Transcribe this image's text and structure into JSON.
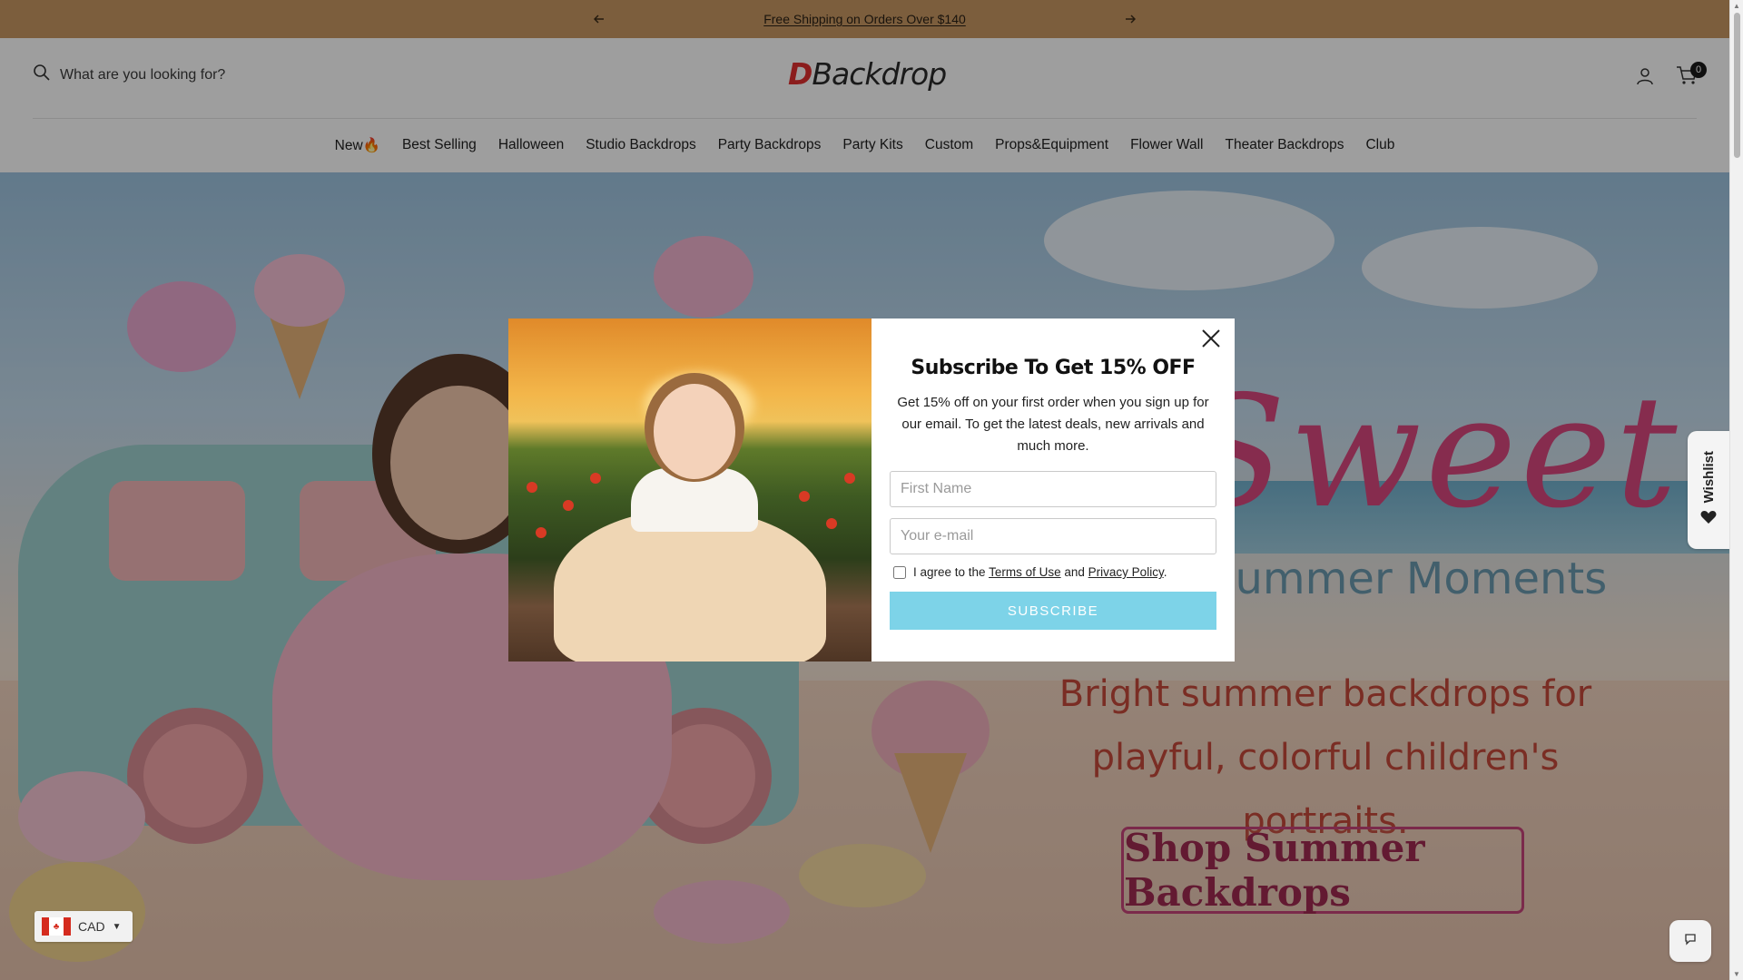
{
  "announcement": {
    "message": "Free Shipping on Orders Over $140"
  },
  "header": {
    "search_placeholder": "What are you looking for?",
    "logo_letter": "D",
    "logo_rest": "Backdrop",
    "cart_count": "0"
  },
  "nav": {
    "items": [
      {
        "label": "New🔥"
      },
      {
        "label": "Best Selling"
      },
      {
        "label": "Halloween"
      },
      {
        "label": "Studio Backdrops"
      },
      {
        "label": "Party Backdrops"
      },
      {
        "label": "Party Kits"
      },
      {
        "label": "Custom"
      },
      {
        "label": "Props&Equipment"
      },
      {
        "label": "Flower Wall"
      },
      {
        "label": "Theater Backdrops"
      },
      {
        "label": "Club"
      }
    ]
  },
  "hero": {
    "script_title": "Sweet",
    "tagline": "Summer Moments",
    "subtitle": "Bright summer backdrops for playful, colorful children's portraits.",
    "cta": "Shop Summer Backdrops"
  },
  "modal": {
    "title": "Subscribe To Get 15% OFF",
    "description": "Get 15% off on your first order when you sign up for our email. To get the latest deals, new arrivals and much more.",
    "first_name_placeholder": "First Name",
    "email_placeholder": "Your e-mail",
    "agree_prefix": "I agree to the",
    "terms_label": "Terms of Use",
    "and_text": "and",
    "privacy_label": "Privacy Policy",
    "period": ".",
    "subscribe_label": "SUBSCRIBE"
  },
  "widgets": {
    "currency_code": "CAD",
    "wishlist_label": "Wishlist"
  },
  "icons": {
    "prev": "chevron-left-icon",
    "next": "chevron-right-icon",
    "search": "search-icon",
    "account": "user-icon",
    "cart": "cart-icon",
    "close": "close-icon",
    "wishlist": "heart-icon",
    "chat": "chat-icon"
  },
  "colors": {
    "announcement_bg": "#c99863",
    "logo_accent": "#e03030",
    "subscribe_bg": "#7dd3e8",
    "cta_border": "#c7447a"
  }
}
